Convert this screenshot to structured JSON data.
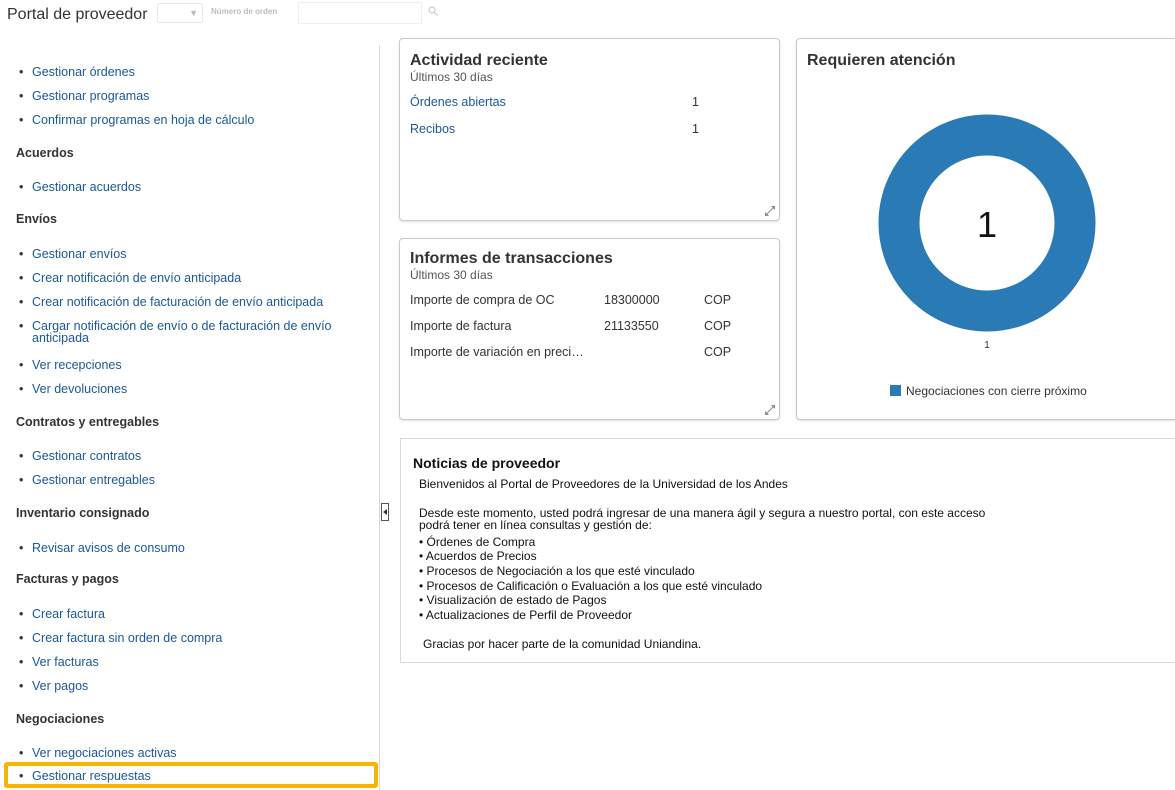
{
  "header": {
    "title": "Portal de proveedor",
    "search_label": "Número de orden",
    "search_value": ""
  },
  "sidebar": {
    "ordenes_items": [
      "Gestionar órdenes",
      "Gestionar programas",
      "Confirmar programas en hoja de cálculo"
    ],
    "acuerdos": {
      "title": "Acuerdos",
      "items": [
        "Gestionar acuerdos"
      ]
    },
    "envios": {
      "title": "Envíos",
      "items": [
        "Gestionar envíos",
        "Crear notificación de envío anticipada",
        "Crear notificación de facturación de envío anticipada",
        "Cargar notificación de envío o de facturación de envío anticipada",
        "Ver recepciones",
        "Ver devoluciones"
      ]
    },
    "contratos": {
      "title": "Contratos y entregables",
      "items": [
        "Gestionar contratos",
        "Gestionar entregables"
      ]
    },
    "inventario": {
      "title": "Inventario consignado",
      "items": [
        "Revisar avisos de consumo"
      ]
    },
    "facturas": {
      "title": "Facturas y pagos",
      "items": [
        "Crear factura",
        "Crear factura sin orden de compra",
        "Ver facturas",
        "Ver pagos"
      ]
    },
    "negociaciones": {
      "title": "Negociaciones",
      "items": [
        "Ver negociaciones activas",
        "Gestionar respuestas"
      ]
    }
  },
  "actividad": {
    "title": "Actividad reciente",
    "subtitle": "Últimos 30 días",
    "rows": [
      {
        "label": "Órdenes abiertas",
        "value": "1"
      },
      {
        "label": "Recibos",
        "value": "1"
      }
    ]
  },
  "informes": {
    "title": "Informes de transacciones",
    "subtitle": "Últimos 30 días",
    "rows": [
      {
        "label": "Importe de compra de OC",
        "value": "18300000",
        "currency": "COP"
      },
      {
        "label": "Importe de factura",
        "value": "21133550",
        "currency": "COP"
      },
      {
        "label": "Importe de variación en preci…",
        "value": "",
        "currency": "COP"
      }
    ]
  },
  "atencion": {
    "title": "Requieren atención",
    "center_value": "1",
    "slice_label": "1",
    "legend": "Negociaciones con cierre próximo",
    "color": "#2a7ab5"
  },
  "chart_data": {
    "type": "pie",
    "title": "Requieren atención",
    "categories": [
      "Negociaciones con cierre próximo"
    ],
    "values": [
      1
    ],
    "legend": "bottom"
  },
  "news": {
    "title": "Noticias de proveedor",
    "lines": [
      "Bienvenidos al Portal de Proveedores de la Universidad de los Andes",
      "Desde este momento, usted podrá ingresar de una manera ágil y segura a nuestro portal, con este acceso",
      "podrá tener en línea consultas y gestión de:",
      "• Órdenes de Compra",
      "• Acuerdos de Precios",
      "• Procesos de Negociación a los que esté vinculado",
      "• Procesos de Calificación o Evaluación a los que esté vinculado",
      "• Visualización de estado de Pagos",
      "• Actualizaciones de Perfil de Proveedor",
      "Gracias por hacer parte de la comunidad Uniandina."
    ]
  }
}
